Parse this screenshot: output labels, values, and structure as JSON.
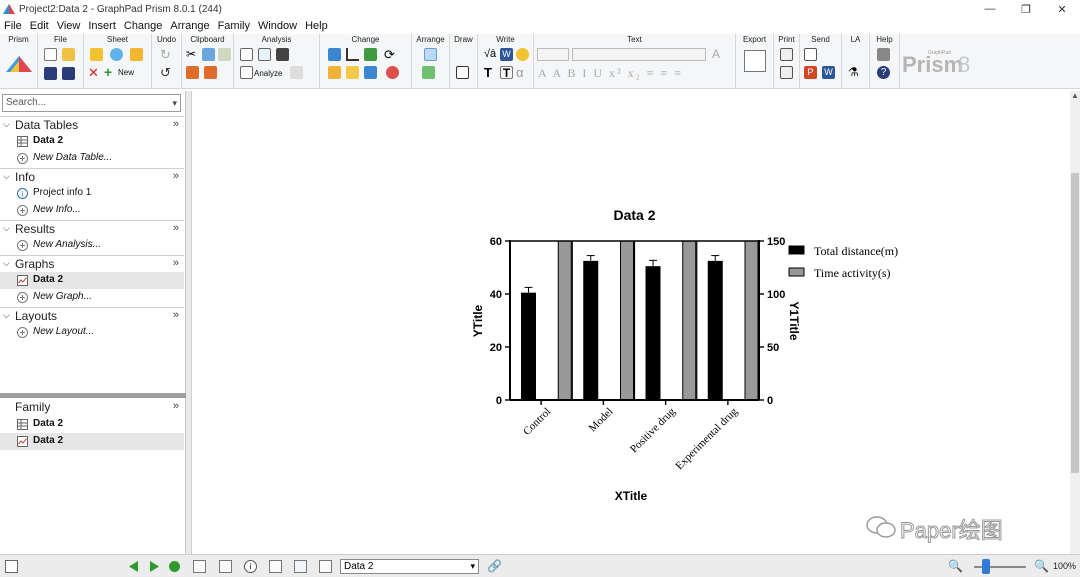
{
  "window": {
    "title": "Project2:Data 2 - GraphPad Prism 8.0.1 (244)",
    "controls": [
      "—",
      "❐",
      "✕"
    ]
  },
  "menu": [
    "File",
    "Edit",
    "View",
    "Insert",
    "Change",
    "Arrange",
    "Family",
    "Window",
    "Help"
  ],
  "ribbon": {
    "groups": [
      "Prism",
      "File",
      "Sheet",
      "Undo",
      "Clipboard",
      "Analysis",
      "Change",
      "Arrange",
      "Draw",
      "Write",
      "Text",
      "Export",
      "Print",
      "Send",
      "LA",
      "Help"
    ],
    "new_label": "New",
    "analyze_label": "Analyze",
    "brand": "Prism",
    "brand_version": "8",
    "brand_small": "GraphPad"
  },
  "navigator": {
    "search_placeholder": "Search...",
    "sections": [
      {
        "name": "Data Tables",
        "items": [
          {
            "label": "Data 2",
            "icon": "table-icon",
            "bold": true
          },
          {
            "label": "New Data Table...",
            "icon": "plus-circle-icon",
            "italic": true
          }
        ]
      },
      {
        "name": "Info",
        "items": [
          {
            "label": "Project info 1",
            "icon": "info-icon"
          },
          {
            "label": "New Info...",
            "icon": "plus-circle-icon",
            "italic": true
          }
        ]
      },
      {
        "name": "Results",
        "items": [
          {
            "label": "New Analysis...",
            "icon": "plus-circle-icon",
            "italic": true
          }
        ]
      },
      {
        "name": "Graphs",
        "items": [
          {
            "label": "Data 2",
            "icon": "graph-icon",
            "bold": true,
            "selected": true
          },
          {
            "label": "New Graph...",
            "icon": "plus-circle-icon",
            "italic": true
          }
        ]
      },
      {
        "name": "Layouts",
        "items": [
          {
            "label": "New Layout...",
            "icon": "plus-circle-icon",
            "italic": true
          }
        ]
      }
    ],
    "family": {
      "name": "Family",
      "items": [
        {
          "label": "Data 2",
          "icon": "table-icon",
          "bold": true
        },
        {
          "label": "Data 2",
          "icon": "graph-icon",
          "bold": true,
          "selected": true
        }
      ]
    }
  },
  "status": {
    "sheet": "Data 2",
    "zoom": "100%"
  },
  "watermark": "Paper绘图",
  "chart_data": {
    "type": "bar",
    "title": "Data 2",
    "xlabel": "XTitle",
    "ylabel": "YTitle",
    "y2label": "Y1Title",
    "categories": [
      "Control",
      "Model",
      "Positive drug",
      "Experimental drug"
    ],
    "ylim": [
      0,
      60
    ],
    "yticks": [
      0,
      20,
      40,
      60
    ],
    "y2lim": [
      0,
      150
    ],
    "y2ticks": [
      0,
      50,
      100,
      150
    ],
    "series": [
      {
        "name": "Total distance(m)",
        "axis": "left",
        "color": "#000000",
        "values": [
          40.5,
          52.5,
          50.5,
          52.5
        ],
        "errors": [
          2.0,
          2.0,
          2.2,
          2.0
        ]
      },
      {
        "name": "Time activity(s)",
        "axis": "right",
        "color": "#999999",
        "values": [
          150,
          150,
          150,
          150
        ]
      }
    ],
    "legend": "right"
  }
}
